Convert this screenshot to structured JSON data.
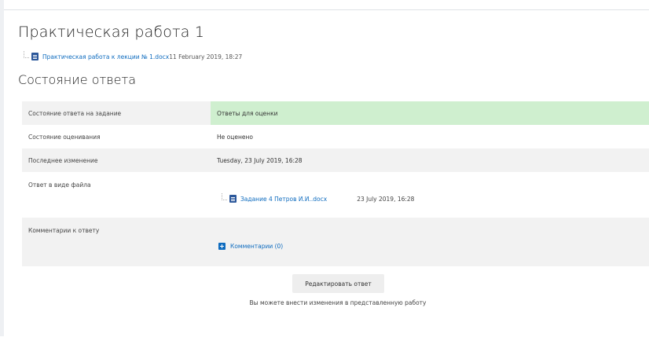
{
  "page": {
    "title": "Практическая работа 1"
  },
  "intro_attachment": {
    "file_name": "Практическая работа к лекции № 1.docx",
    "date_text": "11 February 2019, 18:27"
  },
  "submission": {
    "section_title": "Состояние ответа",
    "rows": [
      {
        "label": "Состояние ответа на задание",
        "value": "Ответы для оценки"
      },
      {
        "label": "Состояние оценивания",
        "value": "Не оценено"
      },
      {
        "label": "Последнее изменение",
        "value": "Tuesday, 23 July 2019, 16:28"
      },
      {
        "label": "Ответ в виде файла",
        "file_name": "Задание 4 Петров И.И..docx",
        "file_date": "23 July 2019, 16:28"
      },
      {
        "label": "Комментарии к ответу",
        "comments_link": "Комментарии (0)"
      }
    ]
  },
  "actions": {
    "edit_button": "Редактировать ответ",
    "helper_text": "Вы можете внести изменения в представленную работу"
  },
  "colors": {
    "link": "#0f6cbf",
    "submitted_bg": "#cfefcf",
    "row_shade": "#f2f2f2",
    "button_bg": "#eeeeee"
  },
  "icons": {
    "attachment": "word-doc-icon",
    "comments": "plus-square-icon"
  }
}
